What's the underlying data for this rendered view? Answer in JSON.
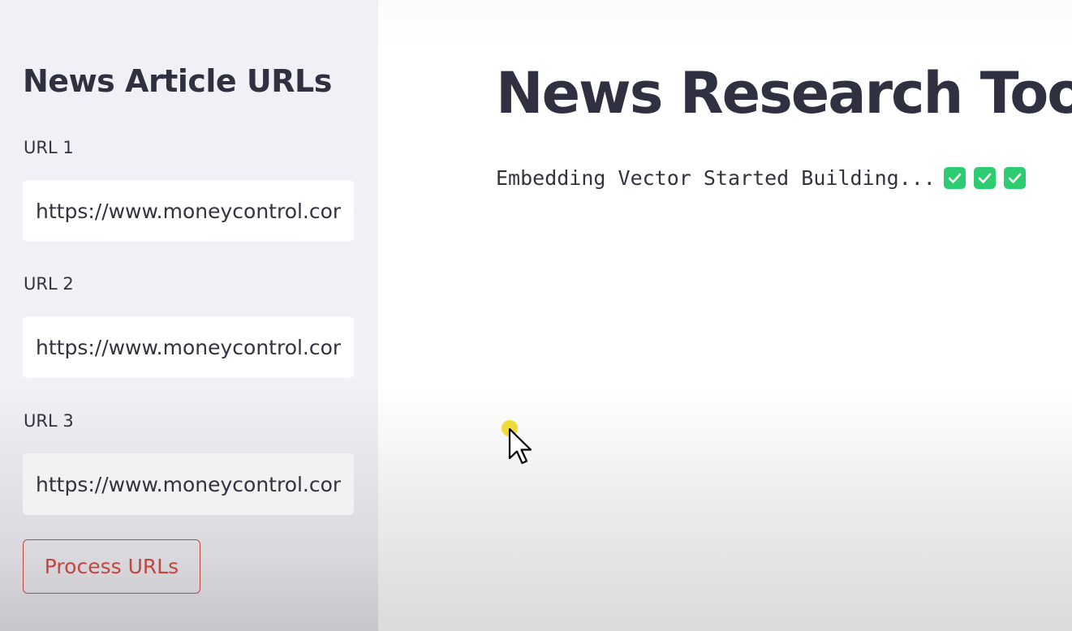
{
  "sidebar": {
    "title": "News Article URLs",
    "fields": [
      {
        "label": "URL 1",
        "value": "https://www.moneycontrol.com"
      },
      {
        "label": "URL 2",
        "value": "https://www.moneycontrol.com"
      },
      {
        "label": "URL 3",
        "value": "https://www.moneycontrol.com"
      }
    ],
    "process_button": "Process URLs"
  },
  "main": {
    "title": "News Research Tool",
    "status": "Embedding Vector Started Building...",
    "status_icons": [
      "check-mark-button-icon",
      "check-mark-button-icon",
      "check-mark-button-icon"
    ]
  },
  "colors": {
    "accent": "#c2453f",
    "check_green": "#2ecc71",
    "text": "#31333f"
  }
}
